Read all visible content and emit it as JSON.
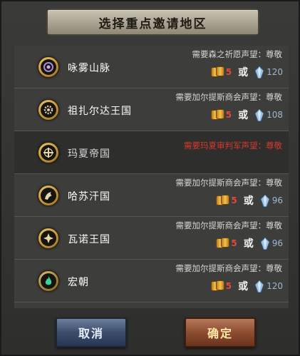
{
  "title": "选择重点邀请地区",
  "or_label": "或",
  "regions": [
    {
      "name": "咏雾山脉",
      "requirement": "需要森之祈愿声望：尊敬",
      "gold": "5",
      "crystal": "120",
      "locked": false,
      "icon": "vortex-emblem-icon"
    },
    {
      "name": "祖扎尔达王国",
      "requirement": "需要加尔提斯商会声望：尊敬",
      "gold": "5",
      "crystal": "108",
      "locked": false,
      "icon": "gear-emblem-icon"
    },
    {
      "name": "玛夏帝国",
      "requirement": "需要玛夏审判军声望：尊敬",
      "gold": "",
      "crystal": "",
      "locked": true,
      "icon": "cross-emblem-icon"
    },
    {
      "name": "哈苏汗国",
      "requirement": "需要加尔提斯商会声望：尊敬",
      "gold": "5",
      "crystal": "96",
      "locked": false,
      "icon": "beast-emblem-icon"
    },
    {
      "name": "瓦诺王国",
      "requirement": "需要加尔提斯商会声望：尊敬",
      "gold": "5",
      "crystal": "96",
      "locked": false,
      "icon": "star-emblem-icon"
    },
    {
      "name": "宏朝",
      "requirement": "需要加尔提斯商会声望：尊敬",
      "gold": "5",
      "crystal": "120",
      "locked": false,
      "icon": "flame-emblem-icon"
    }
  ],
  "buttons": {
    "cancel": "取消",
    "confirm": "确定"
  },
  "colors": {
    "locked_requirement": "#d63a2a",
    "gold_amount": "#e14a3a",
    "confirm_text": "#ffe9a8"
  }
}
